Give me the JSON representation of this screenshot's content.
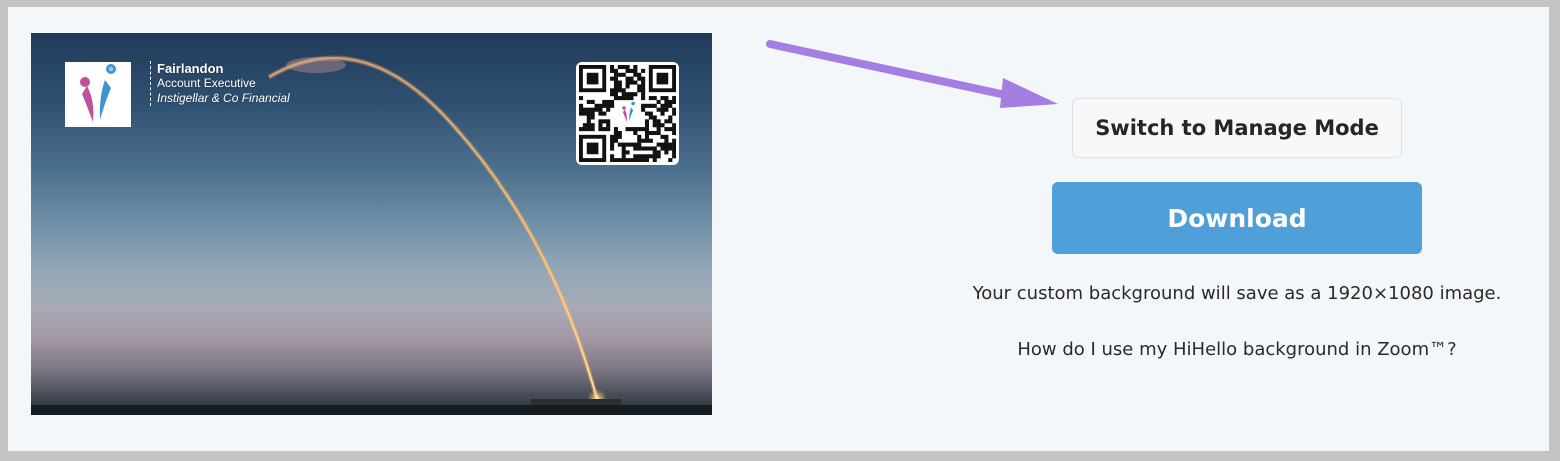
{
  "card": {
    "name": "Fairlandon",
    "job_title": "Account Executive",
    "company": "Instigellar & Co Financial"
  },
  "actions": {
    "manage_mode_label": "Switch to Manage Mode",
    "download_label": "Download"
  },
  "info": {
    "resolution_note": "Your custom background will save as a 1920×1080 image.",
    "help_link": "How do I use my HiHello background in Zoom™?"
  },
  "colors": {
    "download_button": "#4f9fd8",
    "annotation_arrow": "#a57ee3",
    "panel_background": "#f4f7fa"
  },
  "icons": {
    "logo": "hihello-people-logo",
    "qr": "qr-code",
    "arrow": "annotation-arrow"
  }
}
